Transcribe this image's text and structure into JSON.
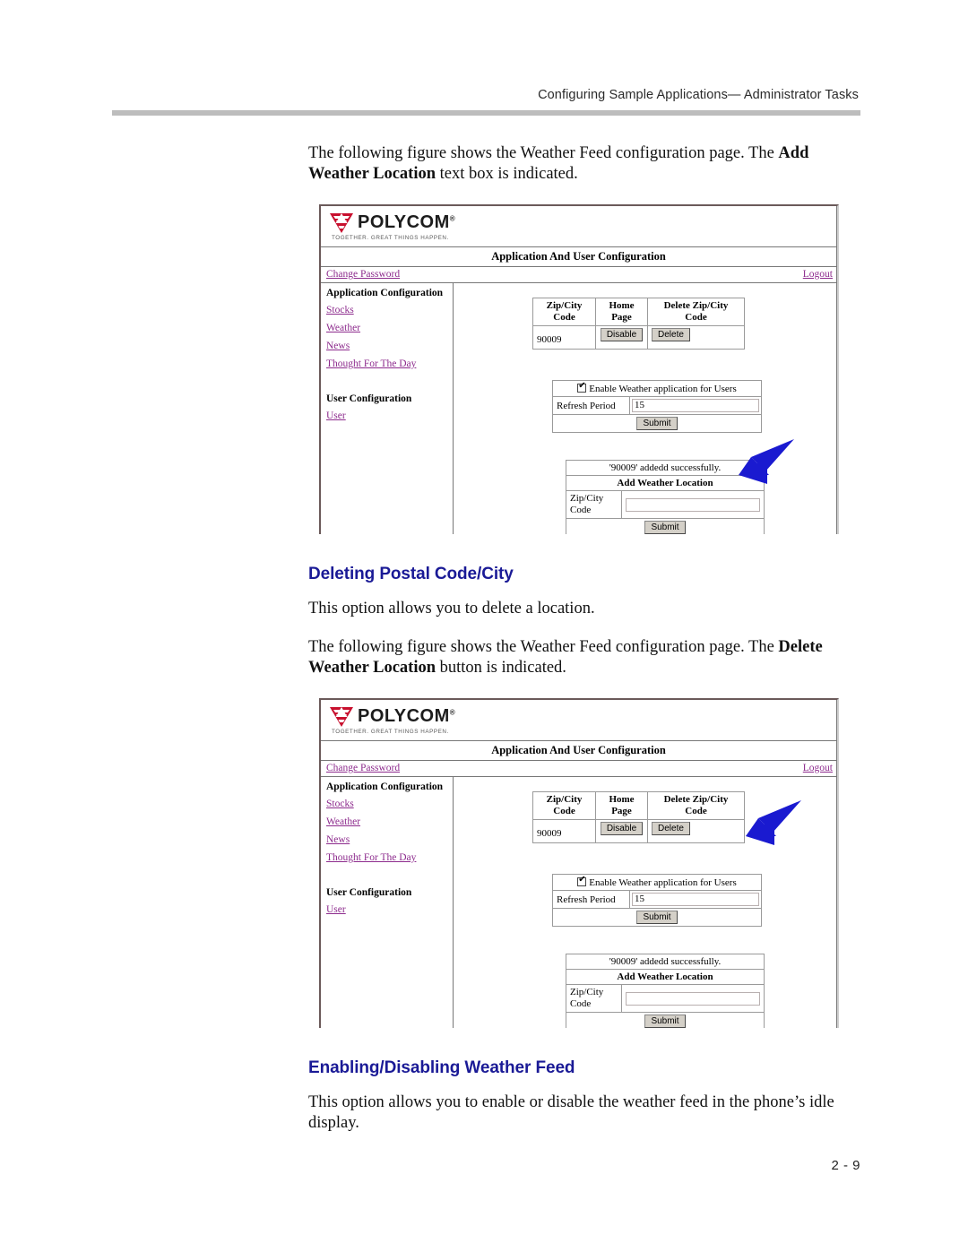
{
  "header": {
    "running_head": "Configuring Sample Applications— Administrator Tasks"
  },
  "footer": {
    "page_number": "2 - 9"
  },
  "colors": {
    "heading_blue": "#1a1a96",
    "arrow_blue": "#1a1ad0",
    "link_purple": "#8d2b8d",
    "logo_red": "#c8102e",
    "rule_gray": "#bdbdbd"
  },
  "body": {
    "intro_paragraph": {
      "prefix": "The following figure shows the Weather Feed configuration page. The ",
      "bold": "Add Weather Location",
      "suffix": " text box is indicated."
    },
    "section_deleting": {
      "heading": "Deleting Postal Code/City",
      "paragraph1": "This option allows you to delete a location.",
      "paragraph2": {
        "prefix": "The following figure shows the Weather Feed configuration page. The ",
        "bold": "Delete Weather Location",
        "suffix": " button is indicated."
      }
    },
    "section_enabling": {
      "heading": "Enabling/Disabling Weather Feed",
      "paragraph1": "This option allows you to enable or disable the weather feed in the phone’s idle display."
    }
  },
  "figure": {
    "brand": {
      "wordmark": "POLYCOM",
      "trademark": "®",
      "tagline": "TOGETHER. GREAT THINGS HAPPEN."
    },
    "title": "Application And User Configuration",
    "links": {
      "change_password": "Change Password",
      "logout": "Logout"
    },
    "sidebar": {
      "app_config_heading": "Application Configuration",
      "app_links": [
        "Stocks",
        "Weather",
        "News",
        "Thought For The Day"
      ],
      "user_config_heading": "User Configuration",
      "user_links": [
        "User"
      ]
    },
    "zip_table": {
      "headers": [
        "Zip/City Code",
        "Home Page",
        "Delete Zip/City Code"
      ],
      "rows": [
        {
          "zip": "90009",
          "home_page_button": "Disable",
          "delete_button": "Delete"
        }
      ]
    },
    "enable_panel": {
      "checkbox_label": "Enable Weather application for Users",
      "checkbox_checked": true,
      "refresh_label": "Refresh Period",
      "refresh_value": "15",
      "submit_label": "Submit"
    },
    "add_panel": {
      "status_message": "'90009' addedd successfully.",
      "heading": "Add Weather Location",
      "field_label": "Zip/City Code",
      "field_value": "",
      "field_placeholder": "",
      "submit_label": "Submit"
    }
  },
  "annotations": {
    "figure1_arrow_target": "add-weather-location-heading",
    "figure2_arrow_target": "delete-zip-city-code-column"
  }
}
